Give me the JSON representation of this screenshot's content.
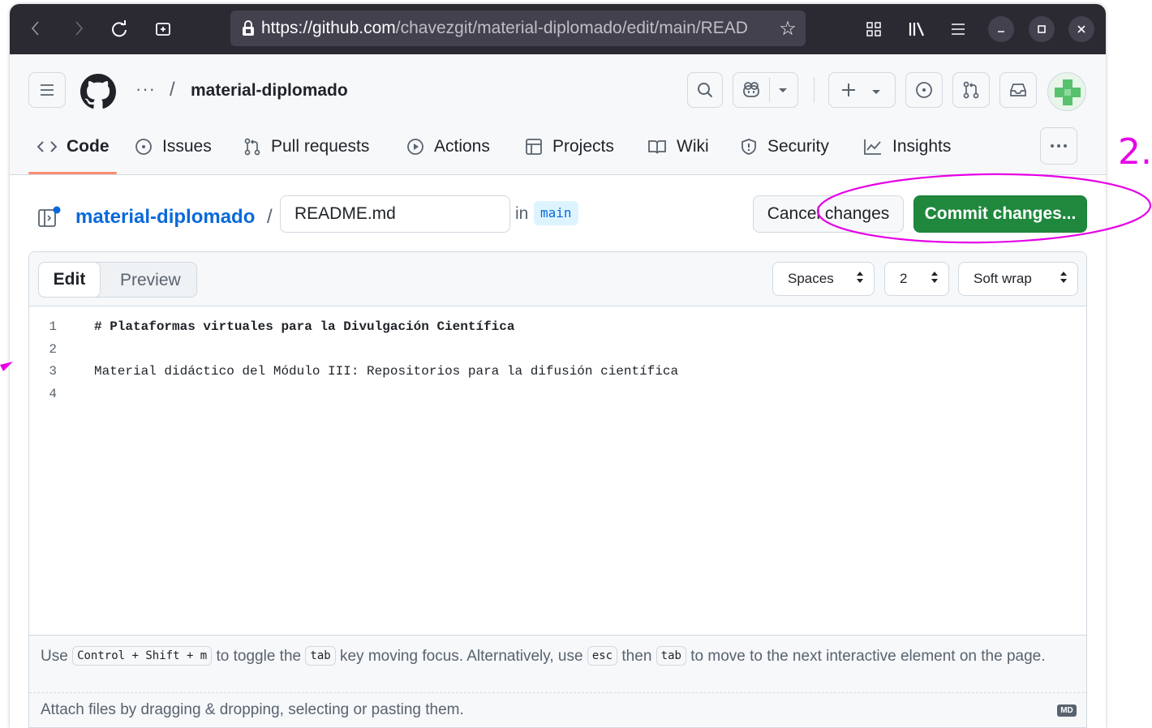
{
  "browser": {
    "url_host": "https://github.com",
    "url_path": "/chavezgit/material-diplomado/edit/main/READ"
  },
  "header": {
    "breadcrumb_dots": "···",
    "repo_name": "material-diplomado"
  },
  "tabs": [
    {
      "label": "Code",
      "icon": "code-icon"
    },
    {
      "label": "Issues",
      "icon": "issue-icon"
    },
    {
      "label": "Pull requests",
      "icon": "pull-request-icon"
    },
    {
      "label": "Actions",
      "icon": "play-icon"
    },
    {
      "label": "Projects",
      "icon": "table-icon"
    },
    {
      "label": "Wiki",
      "icon": "book-icon"
    },
    {
      "label": "Security",
      "icon": "shield-icon"
    },
    {
      "label": "Insights",
      "icon": "graph-icon"
    }
  ],
  "editor": {
    "repo_link": "material-diplomado",
    "path_separator": "/",
    "filename": "README.md",
    "in_label": "in",
    "branch": "main",
    "cancel_label": "Cancel changes",
    "commit_label": "Commit changes...",
    "edit_tab": "Edit",
    "preview_tab": "Preview",
    "indent_mode": "Spaces",
    "indent_size": "2",
    "wrap_mode": "Soft wrap"
  },
  "code_lines": [
    {
      "num": "1",
      "text": "# Plataformas virtuales para la Divulgación Científica"
    },
    {
      "num": "2",
      "text": ""
    },
    {
      "num": "3",
      "text": "Material didáctico del Módulo III: Repositorios para la difusión científica"
    },
    {
      "num": "4",
      "text": ""
    }
  ],
  "help": {
    "use": "Use",
    "kbd_toggle": "Control + Shift + m",
    "to_toggle": "to toggle the",
    "kbd_tab": "tab",
    "key_moving": "key moving focus. Alternatively, use",
    "kbd_esc": "esc",
    "then": "then",
    "kbd_tab2": "tab",
    "to_move": "to move to the next interactive element on the page."
  },
  "attach_text": "Attach files by dragging & dropping, selecting or pasting them.",
  "md_badge": "MD",
  "annotation": {
    "label": "2.",
    "color": "#e600e6"
  },
  "colors": {
    "commit_green": "#1f883d",
    "link_blue": "#0969da",
    "tab_underline": "#fd8c73"
  }
}
